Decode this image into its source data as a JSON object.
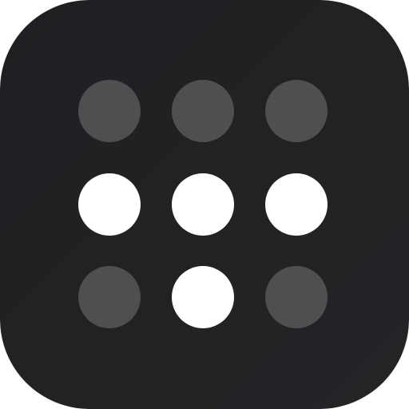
{
  "icon": {
    "name": "dots-grid-app-icon",
    "background": {
      "top_left": "#1f2023",
      "bottom_right": "#252326"
    },
    "dot_colors": {
      "on": "#ffffff",
      "off": "#4f4f52"
    },
    "grid": {
      "rows": 3,
      "cols": 3,
      "states": [
        [
          "off",
          "off",
          "off"
        ],
        [
          "on",
          "on",
          "on"
        ],
        [
          "off",
          "on",
          "off"
        ]
      ]
    }
  }
}
